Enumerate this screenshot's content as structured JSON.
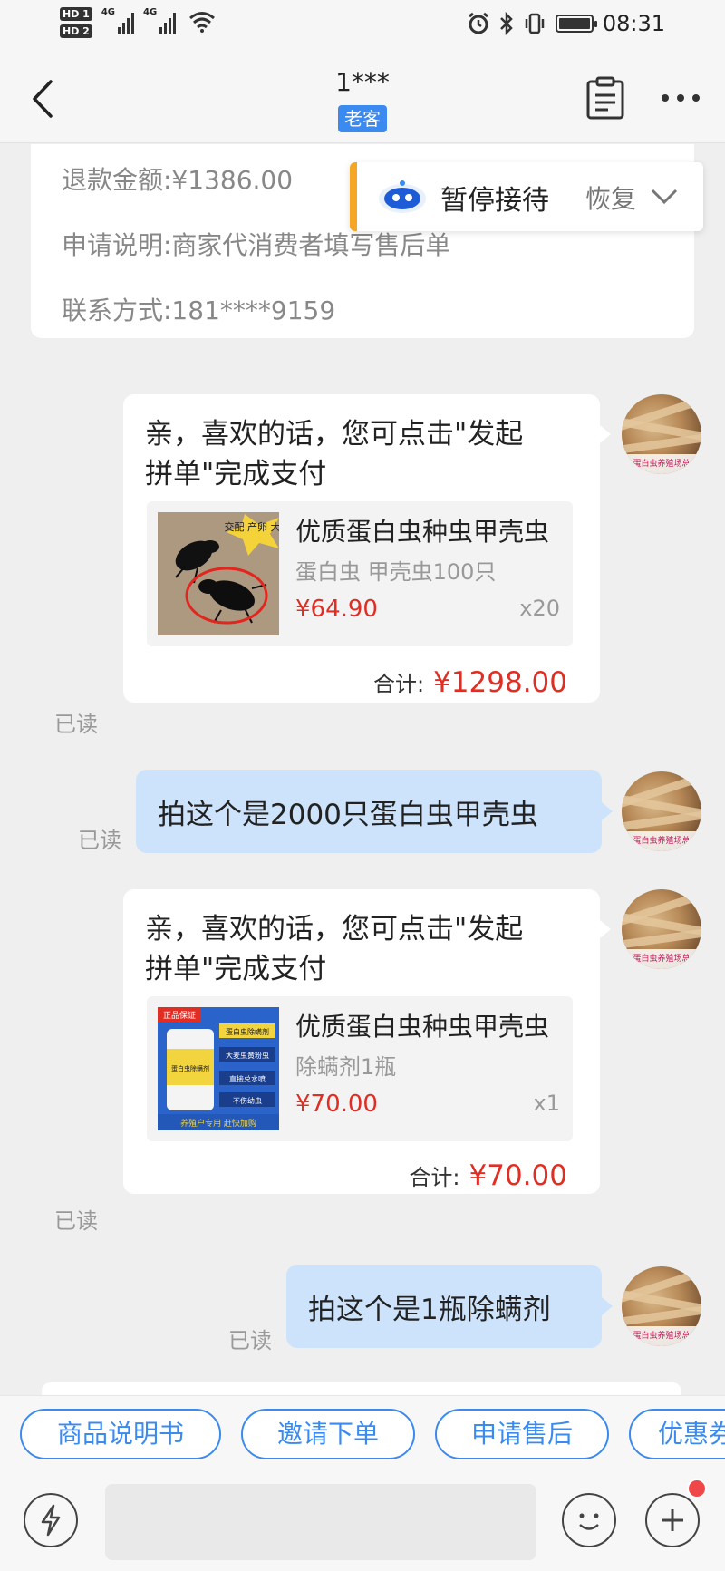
{
  "status_bar": {
    "time": "08:31",
    "sim1": "HD 1",
    "sim2": "HD 2",
    "net1": "4G",
    "net2": "4G"
  },
  "header": {
    "title": "1***",
    "badge": "老客"
  },
  "refund_info": {
    "amount": "退款金额:¥1386.00",
    "description": "申请说明:商家代消费者填写售后单",
    "contact": "联系方式:181****9159"
  },
  "auto_reply": {
    "status": "暂停接待",
    "action": "恢复"
  },
  "messages": [
    {
      "type": "merchant_card",
      "text": "亲，喜欢的话，您可点击\"发起拼单\"完成支付",
      "product": {
        "title": "优质蛋白虫种虫甲壳虫",
        "spec": "蛋白虫 甲壳虫100只",
        "price": "¥64.90",
        "qty": "x20",
        "image_text": "交配 产卵 大量"
      },
      "total_label": "合计:",
      "total": "¥1298.00",
      "read": "已读"
    },
    {
      "type": "text",
      "text": "拍这个是2000只蛋白虫甲壳虫",
      "read": "已读"
    },
    {
      "type": "merchant_card",
      "text": "亲，喜欢的话，您可点击\"发起拼单\"完成支付",
      "product": {
        "title": "优质蛋白虫种虫甲壳虫",
        "spec": "除螨剂1瓶",
        "price": "¥70.00",
        "qty": "x1",
        "image_text": {
          "tag": "正品保证",
          "bottle": "蛋白虫除螨剂",
          "l1": "蛋白虫除螨剂",
          "l2": "大麦虫黄粉虫",
          "l3": "直接兑水喷",
          "l4": "不伤幼虫",
          "bottom": "养殖户专用 赶快加购"
        }
      },
      "total_label": "合计:",
      "total": "¥70.00",
      "read": "已读"
    },
    {
      "type": "text",
      "text": "拍这个是1瓶除螨剂",
      "read": "已读"
    }
  ],
  "avatar_caption": "蛋白虫养殖场总",
  "quick_replies": [
    "商品说明书",
    "邀请下单",
    "申请售后",
    "优惠券"
  ],
  "colors": {
    "accent_blue": "#3b8af0",
    "price_red": "#e02e24",
    "bubble_blue": "#cce3fb",
    "pause_bar": "#f5a623"
  },
  "icons": [
    "back-arrow-icon",
    "clipboard-icon",
    "more-icon",
    "robot-icon",
    "chevron-down-icon",
    "lightning-icon",
    "emoji-icon",
    "plus-icon"
  ]
}
